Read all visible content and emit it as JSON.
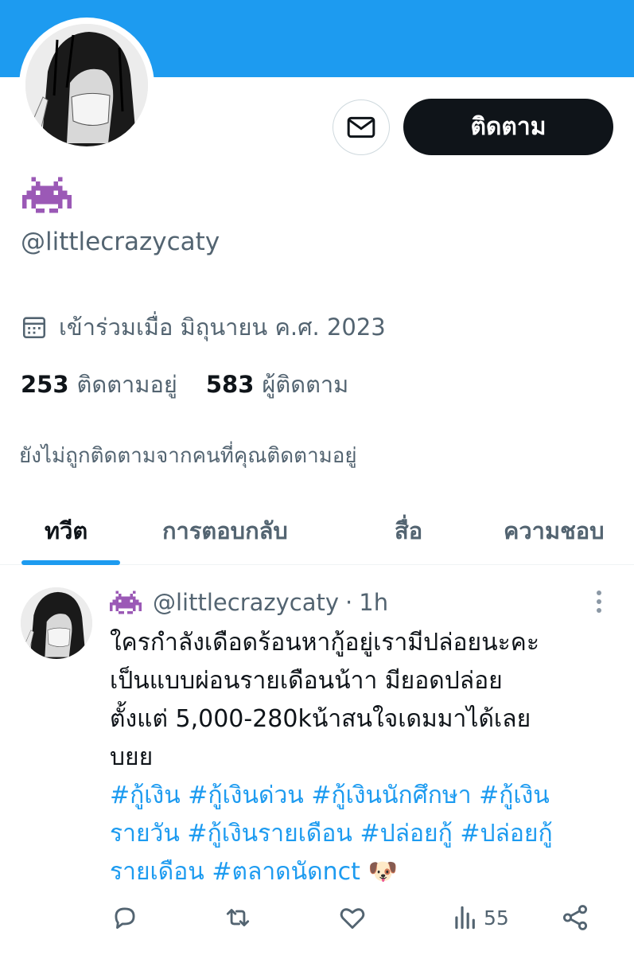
{
  "profile": {
    "display_name_icon": "alien-monster-icon",
    "handle": "@littlecrazycaty",
    "message_icon": "envelope-icon",
    "follow_label": "ติดตาม",
    "joined_icon": "calendar-icon",
    "joined_text": "เข้าร่วมเมื่อ มิถุนายน ค.ศ. 2023",
    "following_count": "253",
    "following_label": "ติดตามอยู่",
    "followers_count": "583",
    "followers_label": "ผู้ติดตาม",
    "not_followed_text": "ยังไม่ถูกติดตามจากคนที่คุณติดตามอยู่"
  },
  "tabs": [
    {
      "label": "ทวีต",
      "active": true
    },
    {
      "label": "การตอบกลับ",
      "active": false
    },
    {
      "label": "สื่อ",
      "active": false
    },
    {
      "label": "ความชอบ",
      "active": false
    }
  ],
  "tweet": {
    "handle": "@littlecrazycaty",
    "separator": "·",
    "time": "1h",
    "lines": [
      "ใครกำลังเดือดร้อนหากู้อยู่เรามีปล่อยนะคะ",
      "เป็นแบบผ่อนรายเดือนน้าา มียอดปล่อย",
      "ตั้งแต่ 5,000-280kน้าสนใจเดมมาได้เลย",
      "บยย"
    ],
    "hashtag_lines": [
      "#กู้เงิน #กู้เงินด่วน #กู้เงินนักศึกษา #กู้เงิน",
      "รายวัน #กู้เงินรายเดือน #ปล่อยกู้ #ปล่อยกู้",
      "รายเดือน #ตลาดนัดnct 🐶"
    ],
    "views": "55",
    "action_icons": [
      "reply-icon",
      "retweet-icon",
      "like-icon",
      "views-icon",
      "share-icon"
    ]
  },
  "colors": {
    "banner": "#1d9bf0",
    "accent": "#1d9bf0",
    "text_primary": "#0f1419",
    "text_secondary": "#536471",
    "alien": "#9b59b6"
  }
}
